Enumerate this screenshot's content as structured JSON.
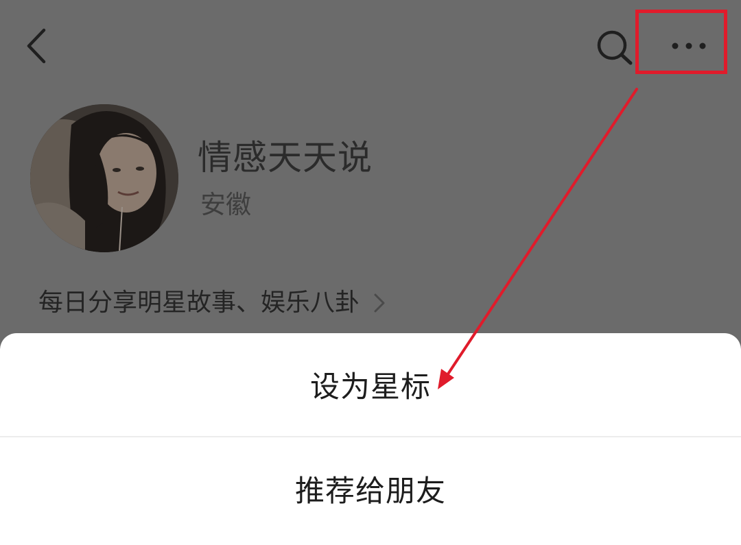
{
  "header": {
    "back_icon": "chevron-left-icon",
    "search_icon": "search-icon",
    "more_icon": "more-horizontal-icon"
  },
  "profile": {
    "name": "情感天天说",
    "region": "安徽",
    "intro": "每日分享明星故事、娱乐八卦",
    "intro_chevron": "chevron-right-icon"
  },
  "action_sheet": {
    "items": [
      {
        "label": "设为星标"
      },
      {
        "label": "推荐给朋友"
      }
    ]
  },
  "annotation": {
    "color": "#e01b2b"
  },
  "colors": {
    "dim_overlay": "#6b6b6b",
    "sheet_background": "#ffffff",
    "annotation": "#e01b2b"
  }
}
